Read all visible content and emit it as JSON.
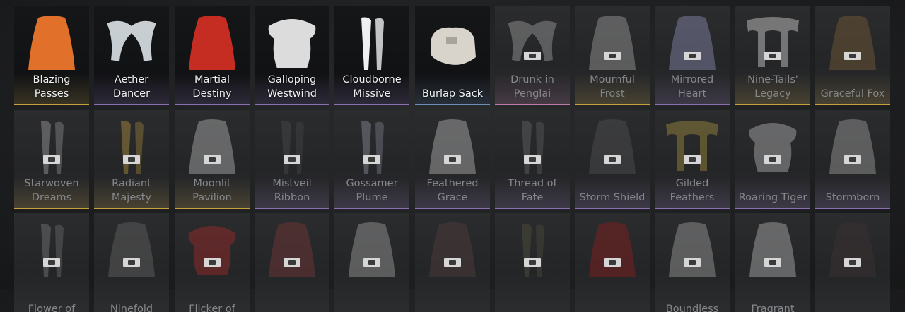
{
  "rarity_colors": {
    "gold": "#c7a23a",
    "purple": "#8a6fb5",
    "blue": "#6c8fb8",
    "pink": "#c07aa8"
  },
  "cards": [
    {
      "label": "Blazing Passes",
      "state": "unlocked",
      "rarity": "gold",
      "art": "cape-fire-icon",
      "tint": "#e0702a"
    },
    {
      "label": "Aether Dancer",
      "state": "unlocked",
      "rarity": "purple",
      "art": "ribbon-wings-icon",
      "tint": "#e8eef2"
    },
    {
      "label": "Martial Destiny",
      "state": "unlocked",
      "rarity": "purple",
      "art": "cape-red-icon",
      "tint": "#c52d22"
    },
    {
      "label": "Galloping Westwind",
      "state": "unlocked",
      "rarity": "purple",
      "art": "fur-shawl-icon",
      "tint": "#dcdcdc"
    },
    {
      "label": "Cloudborne Missive",
      "state": "unlocked",
      "rarity": "purple",
      "art": "scroll-ribbon-icon",
      "tint": "#eef0f2"
    },
    {
      "label": "Burlap Sack",
      "state": "unlocked",
      "rarity": "blue",
      "art": "sack-icon",
      "tint": "#d8d4cc"
    },
    {
      "label": "Drunk in Penglai",
      "state": "locked",
      "rarity": "pink",
      "art": "feather-wings-icon",
      "tint": "#9a9a9a"
    },
    {
      "label": "Mournful Frost",
      "state": "locked",
      "rarity": "gold",
      "art": "veil-icon",
      "tint": "#8a8a8a"
    },
    {
      "label": "Mirrored Heart",
      "state": "locked",
      "rarity": "purple",
      "art": "thin-cape-icon",
      "tint": "#7a7a9a"
    },
    {
      "label": "Nine-Tails' Legacy",
      "state": "locked",
      "rarity": "gold",
      "art": "tail-scarf-icon",
      "tint": "#b5b5b5"
    },
    {
      "label": "Graceful Fox",
      "state": "locked",
      "rarity": "gold",
      "art": "hooded-cape-icon",
      "tint": "#6a5535"
    },
    {
      "label": "Starwoven Dreams",
      "state": "locked",
      "rarity": "gold",
      "art": "long-ribbons-icon",
      "tint": "#8a8a8a"
    },
    {
      "label": "Radiant Majesty",
      "state": "locked",
      "rarity": "gold",
      "art": "gold-ribbons-icon",
      "tint": "#9a7d3a"
    },
    {
      "label": "Moonlit Pavilion",
      "state": "locked",
      "rarity": "gold",
      "art": "draped-cape-icon",
      "tint": "#9a9a9a"
    },
    {
      "label": "Mistveil Ribbon",
      "state": "locked",
      "rarity": "purple",
      "art": "dark-ribbon-icon",
      "tint": "#444446"
    },
    {
      "label": "Gossamer Plume",
      "state": "locked",
      "rarity": "purple",
      "art": "plume-icon",
      "tint": "#7a7a88"
    },
    {
      "label": "Feathered Grace",
      "state": "locked",
      "rarity": "purple",
      "art": "feather-cape-icon",
      "tint": "#9c9c9c"
    },
    {
      "label": "Thread of Fate",
      "state": "locked",
      "rarity": "purple",
      "art": "thread-icon",
      "tint": "#5a5a5a"
    },
    {
      "label": "Storm Shield",
      "state": "locked",
      "rarity": "purple",
      "art": "dark-cape-icon",
      "tint": "#4a4a4c"
    },
    {
      "label": "Gilded Feathers",
      "state": "locked",
      "rarity": "purple",
      "art": "gilded-scarf-icon",
      "tint": "#8c7a3a"
    },
    {
      "label": "Roaring Tiger",
      "state": "locked",
      "rarity": "purple",
      "art": "fur-mantle-icon",
      "tint": "#9a9a9a"
    },
    {
      "label": "Stormborn",
      "state": "locked",
      "rarity": "purple",
      "art": "pale-cape-icon",
      "tint": "#8a8a8a"
    },
    {
      "label": "Flower of",
      "state": "locked",
      "rarity": "none",
      "art": "flower-staff-icon",
      "tint": "#6a6a6a"
    },
    {
      "label": "Ninefold",
      "state": "locked",
      "rarity": "none",
      "art": "shroud-icon",
      "tint": "#5a5a5a"
    },
    {
      "label": "Flicker of",
      "state": "locked",
      "rarity": "none",
      "art": "red-fur-cape-icon",
      "tint": "#8c2a2a"
    },
    {
      "label": "",
      "state": "locked",
      "rarity": "none",
      "art": "red-veil-icon",
      "tint": "#6a3535"
    },
    {
      "label": "",
      "state": "locked",
      "rarity": "none",
      "art": "white-drape-icon",
      "tint": "#8a8a8a"
    },
    {
      "label": "",
      "state": "locked",
      "rarity": "none",
      "art": "slim-figure-icon",
      "tint": "#4a3a3a"
    },
    {
      "label": "",
      "state": "locked",
      "rarity": "none",
      "art": "slim-staff-icon",
      "tint": "#4a4a3a"
    },
    {
      "label": "",
      "state": "locked",
      "rarity": "none",
      "art": "crimson-banner-icon",
      "tint": "#7a2020"
    },
    {
      "label": "Boundless",
      "state": "locked",
      "rarity": "none",
      "art": "ragged-cape-icon",
      "tint": "#8a8a8a"
    },
    {
      "label": "Fragrant",
      "state": "locked",
      "rarity": "none",
      "art": "white-banner-icon",
      "tint": "#9a9a9a"
    },
    {
      "label": "",
      "state": "locked",
      "rarity": "none",
      "art": "dark-shroud-icon",
      "tint": "#3a3232"
    }
  ]
}
